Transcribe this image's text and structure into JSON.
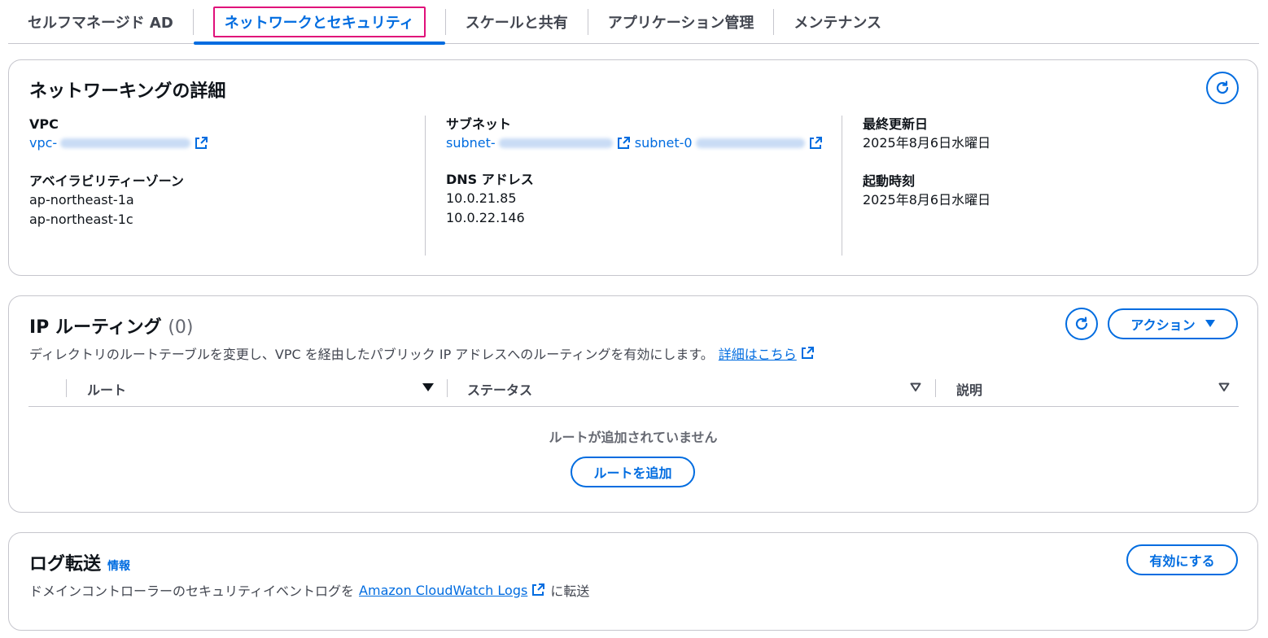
{
  "tabs": [
    {
      "label": "セルフマネージド AD"
    },
    {
      "label": "ネットワークとセキュリティ",
      "active": true
    },
    {
      "label": "スケールと共有"
    },
    {
      "label": "アプリケーション管理"
    },
    {
      "label": "メンテナンス"
    }
  ],
  "network": {
    "title": "ネットワーキングの詳細",
    "vpc_label": "VPC",
    "vpc_value": "vpc-",
    "az_label": "アベイラビリティーゾーン",
    "az_values": [
      "ap-northeast-1a",
      "ap-northeast-1c"
    ],
    "subnet_label": "サブネット",
    "subnet_values": [
      "subnet-",
      "subnet-0"
    ],
    "dns_label": "DNS アドレス",
    "dns_values": [
      "10.0.21.85",
      "10.0.22.146"
    ],
    "updated_label": "最終更新日",
    "updated_value": "2025年8月6日水曜日",
    "launched_label": "起動時刻",
    "launched_value": "2025年8月6日水曜日"
  },
  "routing": {
    "title": "IP ルーティング",
    "count": "(0)",
    "action_label": "アクション",
    "description": "ディレクトリのルートテーブルを変更し、VPC を経由したパブリック IP アドレスへのルーティングを有効にします。",
    "learn_more": "詳細はこちら",
    "columns": [
      "ルート",
      "ステータス",
      "説明"
    ],
    "empty_text": "ルートが追加されていません",
    "add_route_label": "ルートを追加"
  },
  "logs": {
    "title": "ログ転送",
    "info_label": "情報",
    "enable_label": "有効にする",
    "description_prefix": "ドメインコントローラーのセキュリティイベントログを",
    "link_text": "Amazon CloudWatch Logs",
    "description_suffix": "に転送"
  },
  "colors": {
    "accent": "#006ce0",
    "highlight": "#e0107a",
    "border": "#c6c6cd"
  }
}
